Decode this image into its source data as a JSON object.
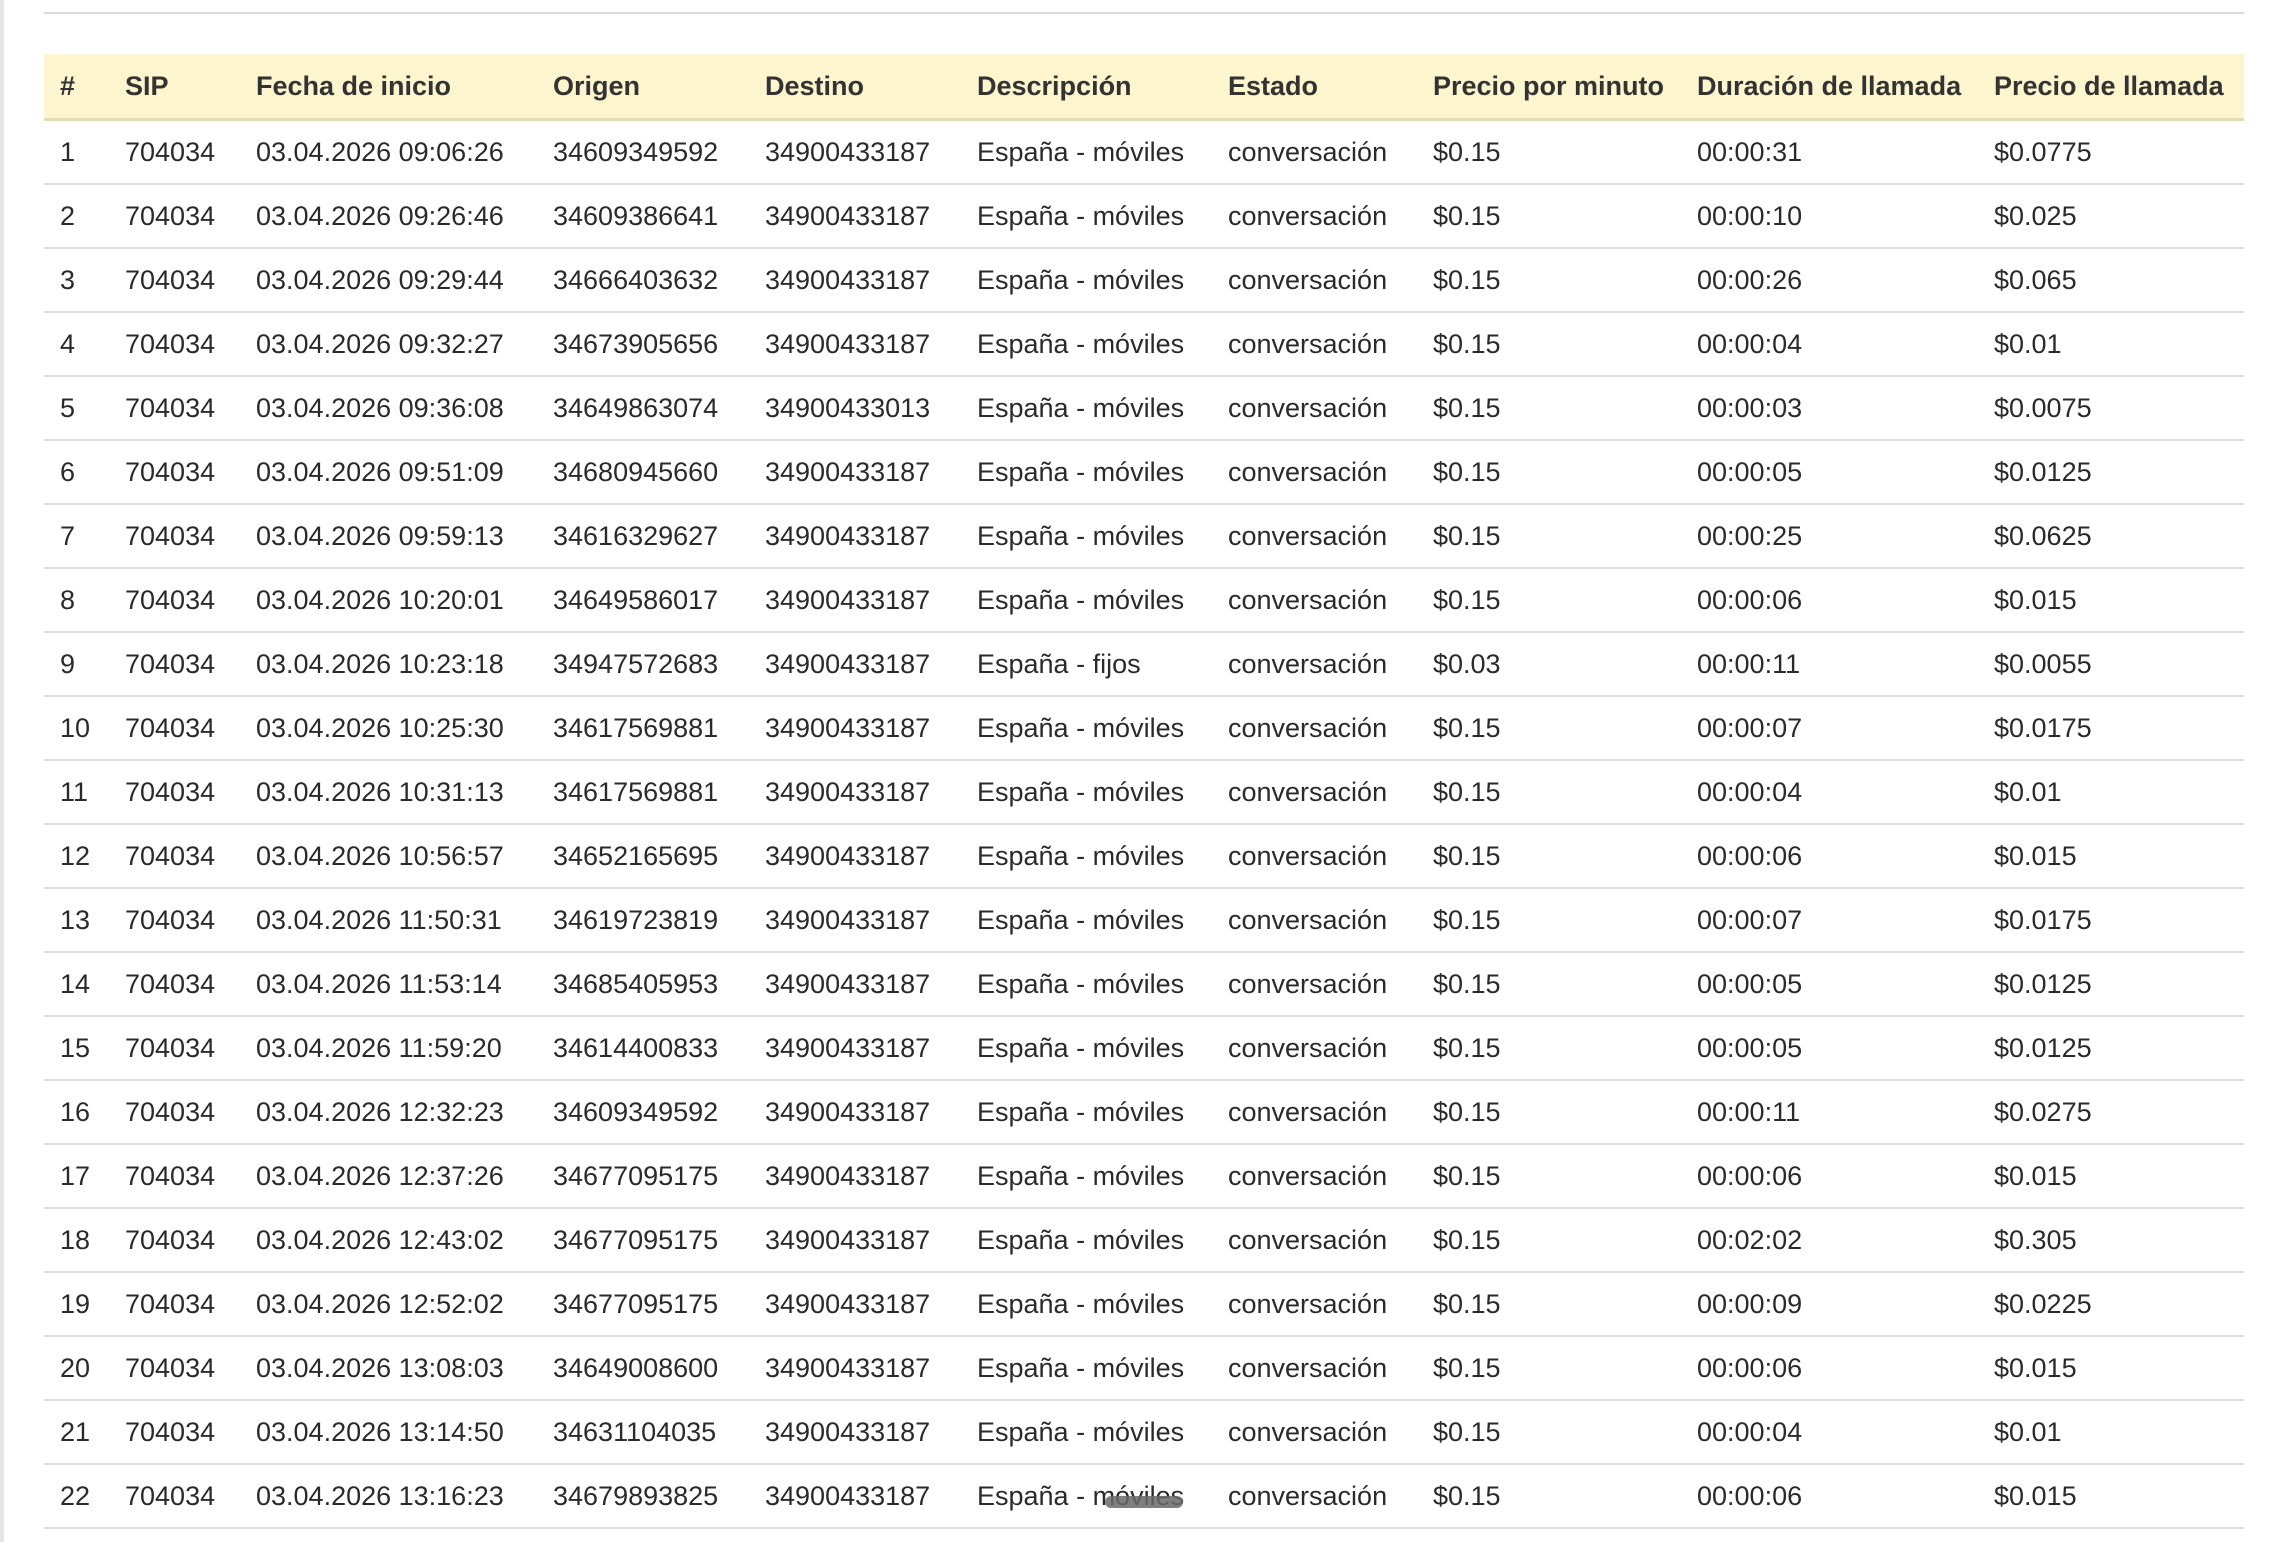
{
  "table": {
    "headers": [
      "#",
      "SIP",
      "Fecha de inicio",
      "Origen",
      "Destino",
      "Descripción",
      "Estado",
      "Precio por minuto",
      "Duración de llamada",
      "Precio de llamada"
    ],
    "rows": [
      [
        "1",
        "704034",
        "03.04.2026 09:06:26",
        "34609349592",
        "34900433187",
        "España - móviles",
        "conversación",
        "$0.15",
        "00:00:31",
        "$0.0775"
      ],
      [
        "2",
        "704034",
        "03.04.2026 09:26:46",
        "34609386641",
        "34900433187",
        "España - móviles",
        "conversación",
        "$0.15",
        "00:00:10",
        "$0.025"
      ],
      [
        "3",
        "704034",
        "03.04.2026 09:29:44",
        "34666403632",
        "34900433187",
        "España - móviles",
        "conversación",
        "$0.15",
        "00:00:26",
        "$0.065"
      ],
      [
        "4",
        "704034",
        "03.04.2026 09:32:27",
        "34673905656",
        "34900433187",
        "España - móviles",
        "conversación",
        "$0.15",
        "00:00:04",
        "$0.01"
      ],
      [
        "5",
        "704034",
        "03.04.2026 09:36:08",
        "34649863074",
        "34900433013",
        "España - móviles",
        "conversación",
        "$0.15",
        "00:00:03",
        "$0.0075"
      ],
      [
        "6",
        "704034",
        "03.04.2026 09:51:09",
        "34680945660",
        "34900433187",
        "España - móviles",
        "conversación",
        "$0.15",
        "00:00:05",
        "$0.0125"
      ],
      [
        "7",
        "704034",
        "03.04.2026 09:59:13",
        "34616329627",
        "34900433187",
        "España - móviles",
        "conversación",
        "$0.15",
        "00:00:25",
        "$0.0625"
      ],
      [
        "8",
        "704034",
        "03.04.2026 10:20:01",
        "34649586017",
        "34900433187",
        "España - móviles",
        "conversación",
        "$0.15",
        "00:00:06",
        "$0.015"
      ],
      [
        "9",
        "704034",
        "03.04.2026 10:23:18",
        "34947572683",
        "34900433187",
        "España - fijos",
        "conversación",
        "$0.03",
        "00:00:11",
        "$0.0055"
      ],
      [
        "10",
        "704034",
        "03.04.2026 10:25:30",
        "34617569881",
        "34900433187",
        "España - móviles",
        "conversación",
        "$0.15",
        "00:00:07",
        "$0.0175"
      ],
      [
        "11",
        "704034",
        "03.04.2026 10:31:13",
        "34617569881",
        "34900433187",
        "España - móviles",
        "conversación",
        "$0.15",
        "00:00:04",
        "$0.01"
      ],
      [
        "12",
        "704034",
        "03.04.2026 10:56:57",
        "34652165695",
        "34900433187",
        "España - móviles",
        "conversación",
        "$0.15",
        "00:00:06",
        "$0.015"
      ],
      [
        "13",
        "704034",
        "03.04.2026 11:50:31",
        "34619723819",
        "34900433187",
        "España - móviles",
        "conversación",
        "$0.15",
        "00:00:07",
        "$0.0175"
      ],
      [
        "14",
        "704034",
        "03.04.2026 11:53:14",
        "34685405953",
        "34900433187",
        "España - móviles",
        "conversación",
        "$0.15",
        "00:00:05",
        "$0.0125"
      ],
      [
        "15",
        "704034",
        "03.04.2026 11:59:20",
        "34614400833",
        "34900433187",
        "España - móviles",
        "conversación",
        "$0.15",
        "00:00:05",
        "$0.0125"
      ],
      [
        "16",
        "704034",
        "03.04.2026 12:32:23",
        "34609349592",
        "34900433187",
        "España - móviles",
        "conversación",
        "$0.15",
        "00:00:11",
        "$0.0275"
      ],
      [
        "17",
        "704034",
        "03.04.2026 12:37:26",
        "34677095175",
        "34900433187",
        "España - móviles",
        "conversación",
        "$0.15",
        "00:00:06",
        "$0.015"
      ],
      [
        "18",
        "704034",
        "03.04.2026 12:43:02",
        "34677095175",
        "34900433187",
        "España - móviles",
        "conversación",
        "$0.15",
        "00:02:02",
        "$0.305"
      ],
      [
        "19",
        "704034",
        "03.04.2026 12:52:02",
        "34677095175",
        "34900433187",
        "España - móviles",
        "conversación",
        "$0.15",
        "00:00:09",
        "$0.0225"
      ],
      [
        "20",
        "704034",
        "03.04.2026 13:08:03",
        "34649008600",
        "34900433187",
        "España - móviles",
        "conversación",
        "$0.15",
        "00:00:06",
        "$0.015"
      ],
      [
        "21",
        "704034",
        "03.04.2026 13:14:50",
        "34631104035",
        "34900433187",
        "España - móviles",
        "conversación",
        "$0.15",
        "00:00:04",
        "$0.01"
      ],
      [
        "22",
        "704034",
        "03.04.2026 13:16:23",
        "34679893825",
        "34900433187",
        "España - móviles",
        "conversación",
        "$0.15",
        "00:00:06",
        "$0.015"
      ]
    ]
  },
  "colors": {
    "header_background": "#fcf5cd",
    "row_divider": "#dedede",
    "text": "#2a2a2a"
  }
}
